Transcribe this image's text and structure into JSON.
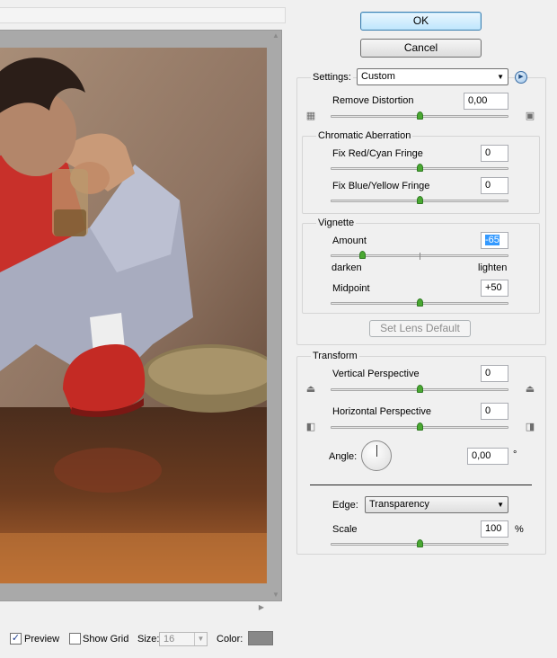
{
  "buttons": {
    "ok": "OK",
    "cancel": "Cancel",
    "set_lens_default": "Set Lens Default"
  },
  "settings": {
    "label": "Settings:",
    "value": "Custom"
  },
  "remove_distortion": {
    "label": "Remove Distortion",
    "value": "0,00",
    "slider_position": 0.5
  },
  "chromatic_aberration": {
    "title": "Chromatic Aberration",
    "red_cyan": {
      "label": "Fix Red/Cyan Fringe",
      "value": "0",
      "slider_position": 0.5
    },
    "blue_yellow": {
      "label": "Fix Blue/Yellow Fringe",
      "value": "0",
      "slider_position": 0.5
    }
  },
  "vignette": {
    "title": "Vignette",
    "amount": {
      "label": "Amount",
      "value": "-65",
      "slider_position": 0.18
    },
    "darken_label": "darken",
    "lighten_label": "lighten",
    "midpoint": {
      "label": "Midpoint",
      "value": "+50",
      "slider_position": 0.5
    }
  },
  "transform": {
    "title": "Transform",
    "vertical": {
      "label": "Vertical Perspective",
      "value": "0",
      "slider_position": 0.5
    },
    "horizontal": {
      "label": "Horizontal Perspective",
      "value": "0",
      "slider_position": 0.5
    },
    "angle": {
      "label": "Angle:",
      "value": "0,00",
      "unit": "°"
    },
    "edge": {
      "label": "Edge:",
      "value": "Transparency"
    },
    "scale": {
      "label": "Scale",
      "value": "100",
      "unit": "%",
      "slider_position": 0.5
    }
  },
  "bottom_bar": {
    "preview_label": "Preview",
    "preview_checked": true,
    "show_grid_label": "Show Grid",
    "show_grid_checked": false,
    "size_label": "Size:",
    "size_value": "16",
    "color_label": "Color:",
    "grid_color": "#888888"
  },
  "icons": {
    "menu": "circle-arrow-right-icon",
    "barrel": "barrel-distortion-icon",
    "pincushion": "pincushion-distortion-icon",
    "vertical_top": "vertical-perspective-top-icon",
    "vertical_bottom": "vertical-perspective-bottom-icon",
    "horizontal_left": "horizontal-perspective-left-icon",
    "horizontal_right": "horizontal-perspective-right-icon"
  }
}
